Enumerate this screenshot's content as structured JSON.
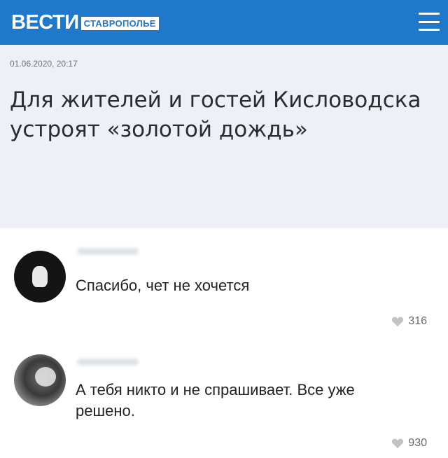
{
  "header": {
    "logo_main": "ВЕСТИ",
    "logo_sub": "СТАВРОПОЛЬЕ",
    "menu_icon": "hamburger-menu-icon",
    "background_color": "#1f78c9"
  },
  "article": {
    "date": "01.06.2020, 20:17",
    "headline": "Для жителей и гостей Кисловодска устроят «золотой дождь»",
    "background_color": "#eef0f8"
  },
  "comments": [
    {
      "text": "Спасибо, чет не хочется",
      "likes": "316",
      "like_icon": "heart-icon"
    },
    {
      "text": "А тебя никто и не спрашивает. Все уже решено.",
      "likes": "930",
      "like_icon": "heart-icon"
    }
  ]
}
